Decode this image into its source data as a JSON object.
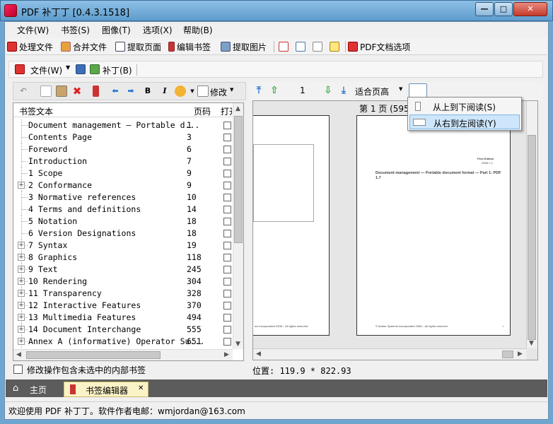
{
  "window": {
    "title": "PDF 补丁丁 [0.4.3.1518]",
    "min": "—",
    "max": "□",
    "close": "✕"
  },
  "menubar": [
    "文件(W)",
    "书签(S)",
    "图像(T)",
    "选项(X)",
    "帮助(B)"
  ],
  "commands": [
    "处理文件",
    "合并文件",
    "提取页面",
    "编辑书签",
    "提取图片",
    "PDF文档选项"
  ],
  "filebar": {
    "file": "文件(W)",
    "patch": "补丁(B)"
  },
  "left_toolbar": {
    "bold": "B",
    "italic": "I",
    "modify": "修改"
  },
  "tree": {
    "headers": {
      "text": "书签文本",
      "page": "页码",
      "open": "打开"
    },
    "rows": [
      {
        "name": "Document management — Portable d...",
        "page": "1",
        "expand": false
      },
      {
        "name": "Contents Page",
        "page": "3",
        "expand": false
      },
      {
        "name": "Foreword",
        "page": "6",
        "expand": false
      },
      {
        "name": "Introduction",
        "page": "7",
        "expand": false
      },
      {
        "name": "1 Scope",
        "page": "9",
        "expand": false
      },
      {
        "name": "2 Conformance",
        "page": "9",
        "expand": true
      },
      {
        "name": "3 Normative references",
        "page": "10",
        "expand": false
      },
      {
        "name": "4 Terms and definitions",
        "page": "14",
        "expand": false
      },
      {
        "name": "5 Notation",
        "page": "18",
        "expand": false
      },
      {
        "name": "6 Version Designations",
        "page": "18",
        "expand": false
      },
      {
        "name": "7 Syntax",
        "page": "19",
        "expand": true
      },
      {
        "name": "8 Graphics",
        "page": "118",
        "expand": true
      },
      {
        "name": "9 Text",
        "page": "245",
        "expand": true
      },
      {
        "name": "10 Rendering",
        "page": "304",
        "expand": true
      },
      {
        "name": "11 Transparency",
        "page": "328",
        "expand": true
      },
      {
        "name": "12 Interactive Features",
        "page": "370",
        "expand": true
      },
      {
        "name": "13 Multimedia Features",
        "page": "494",
        "expand": true
      },
      {
        "name": "14 Document Interchange",
        "page": "555",
        "expand": true
      },
      {
        "name": "Annex A (informative) Operator Su...",
        "page": "651",
        "expand": true
      }
    ]
  },
  "include_unselected": "修改操作包含未选中的内部书签",
  "viewer": {
    "page_number": "1",
    "fit": "适合页高",
    "page_label": "第 1 页 (595",
    "position": "位置: 119.9 * 822.93",
    "dropdown": [
      "从上到下阅读(S)",
      "从右到左阅读(Y)"
    ]
  },
  "pdf_text": {
    "title": "Document management — Portable document format — Part 1: PDF 1.7",
    "edition": "First Edition",
    "date": "2008-7-1",
    "footer_right": "© Adobe Systems Incorporated 2008 – All rights reserved",
    "footer_left": "ms Incorporated 2008 – All rights reserved",
    "footer_page": "i"
  },
  "tabs": {
    "home": "主页",
    "editor": "书签编辑器",
    "close": "✕"
  },
  "status": "欢迎使用 PDF 补丁丁。软件作者电邮：wmjordan@163.com"
}
